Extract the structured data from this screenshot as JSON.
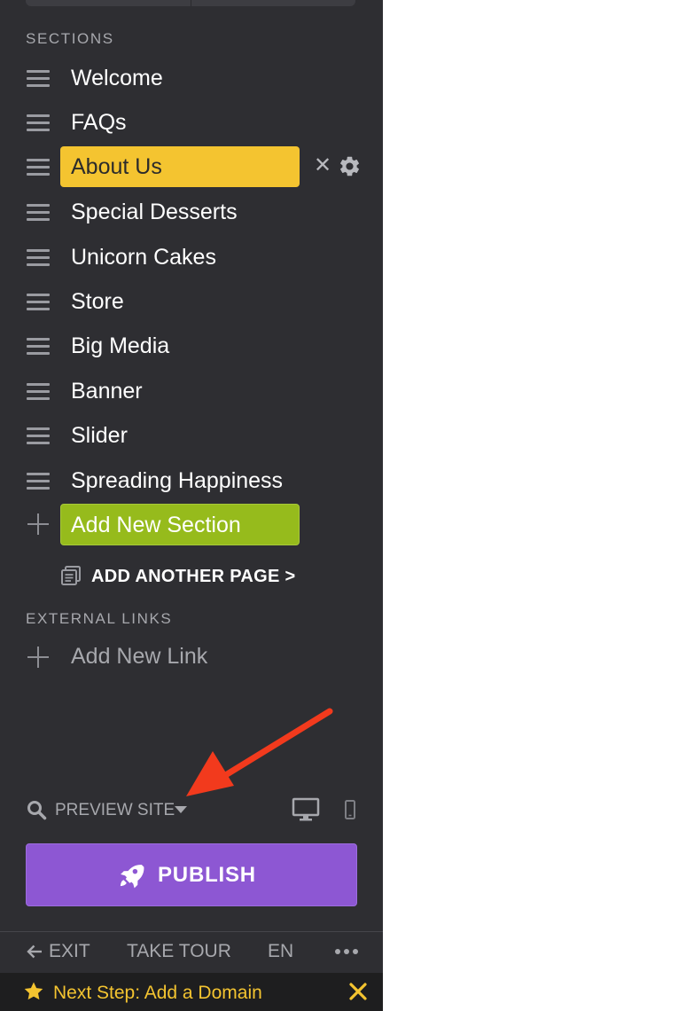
{
  "sections_heading": "SECTIONS",
  "sections": [
    {
      "label": "Welcome",
      "active": false
    },
    {
      "label": "FAQs",
      "active": false
    },
    {
      "label": "About Us",
      "active": true
    },
    {
      "label": "Special Desserts",
      "active": false
    },
    {
      "label": "Unicorn Cakes",
      "active": false
    },
    {
      "label": "Store",
      "active": false
    },
    {
      "label": "Big Media",
      "active": false
    },
    {
      "label": "Banner",
      "active": false
    },
    {
      "label": "Slider",
      "active": false
    },
    {
      "label": "Spreading Happiness",
      "active": false
    }
  ],
  "active_section_actions": {
    "remove_glyph": "✕",
    "settings_icon": "gear-icon"
  },
  "add_section_label": "Add New Section",
  "add_page_label": "ADD ANOTHER PAGE",
  "add_page_chevron": ">",
  "external_links_heading": "EXTERNAL LINKS",
  "add_link_label": "Add New Link",
  "preview": {
    "label": "PREVIEW SITE",
    "device_icons": [
      "desktop-icon",
      "mobile-icon"
    ]
  },
  "publish_label": "PUBLISH",
  "footer": {
    "exit_label": "EXIT",
    "tour_label": "TAKE TOUR",
    "language_label": "EN"
  },
  "next_step_label": "Next Step: Add a Domain",
  "colors": {
    "sidebar_bg": "#2e2e32",
    "active_pill": "#f4c430",
    "add_section": "#96bb1c",
    "publish": "#8d57d3",
    "annotation_arrow": "#f23a1d",
    "next_step_text": "#f4c430"
  }
}
